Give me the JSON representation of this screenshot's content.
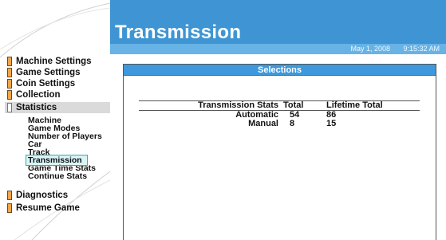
{
  "header": {
    "title": "Transmission",
    "date": "May 1, 2008",
    "time": "9:15:32 AM"
  },
  "sidebar": {
    "items": [
      {
        "label": "Machine Settings"
      },
      {
        "label": "Game Settings"
      },
      {
        "label": "Coin Settings"
      },
      {
        "label": "Collection"
      },
      {
        "label": "Statistics",
        "active": true
      }
    ],
    "sub_items": [
      {
        "label": "Machine"
      },
      {
        "label": "Game Modes"
      },
      {
        "label": "Number of Players"
      },
      {
        "label": "Car"
      },
      {
        "label": "Track"
      },
      {
        "label": "Transmission",
        "selected": true
      },
      {
        "label": "Game Time Stats"
      },
      {
        "label": "Continue Stats"
      }
    ],
    "bottom_items": [
      {
        "label": "Diagnostics"
      },
      {
        "label": "Resume Game"
      }
    ]
  },
  "panel": {
    "title": "Selections"
  },
  "stats_table": {
    "headers": [
      "Transmission Stats",
      "Total",
      "Lifetime Total"
    ],
    "rows": [
      [
        "Automatic",
        "54",
        "86"
      ],
      [
        "Manual",
        "8",
        "15"
      ]
    ]
  },
  "colors": {
    "header_blue": "#3f95d3",
    "date_bar_blue": "#67b3e6",
    "panel_header_blue": "#3d98dc",
    "menu_tab_orange": "#f2a64a",
    "selection_highlight": "#d8f4f6"
  }
}
